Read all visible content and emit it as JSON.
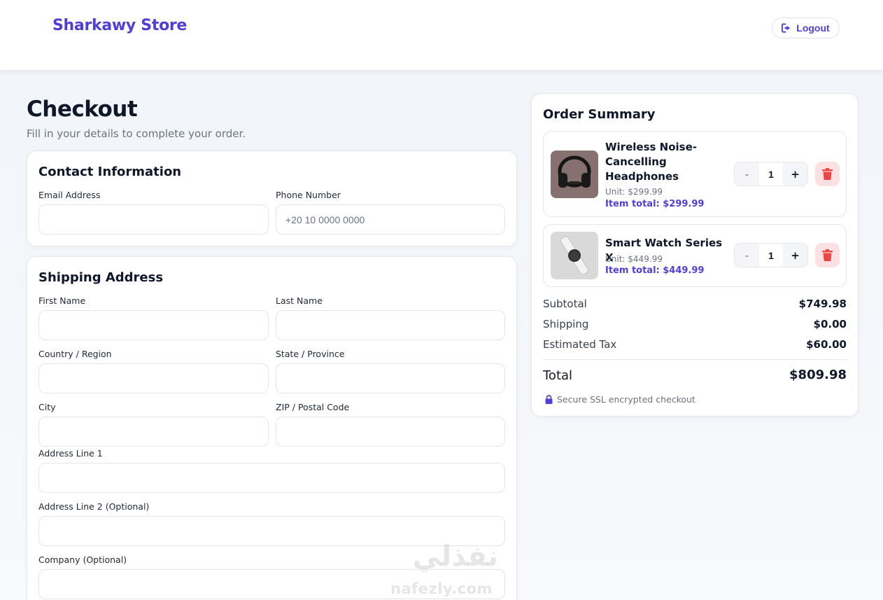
{
  "header": {
    "brand": "Sharkawy Store",
    "logout_label": "Logout"
  },
  "page": {
    "title": "Checkout",
    "subtitle": "Fill in your details to complete your order."
  },
  "contact": {
    "title": "Contact Information",
    "email_label": "Email Address",
    "email_value": "",
    "phone_label": "Phone Number",
    "phone_placeholder": "+20 10 0000 0000"
  },
  "shipping": {
    "title": "Shipping Address",
    "first_name_label": "First Name",
    "last_name_label": "Last Name",
    "country_label": "Country / Region",
    "state_label": "State / Province",
    "city_label": "City",
    "zip_label": "ZIP / Postal Code",
    "address1_label": "Address Line 1",
    "address2_label": "Address Line 2 (Optional)",
    "company_label": "Company (Optional)"
  },
  "summary": {
    "title": "Order Summary",
    "items": [
      {
        "name": "Wireless Noise-Cancelling Headphones",
        "unit": "Unit: $299.99",
        "total": "Item total: $299.99",
        "qty": "1",
        "thumb_icon": "headphones-photo"
      },
      {
        "name": "Smart Watch Series X",
        "unit": "Unit: $449.99",
        "total": "Item total: $449.99",
        "qty": "1",
        "thumb_icon": "smartwatch-photo"
      }
    ],
    "qty_minus": "-",
    "qty_plus": "+",
    "subtotal_label": "Subtotal",
    "subtotal_value": "$749.98",
    "shipping_label": "Shipping",
    "shipping_value": "$0.00",
    "tax_label": "Estimated Tax",
    "tax_value": "$60.00",
    "total_label": "Total",
    "total_value": "$809.98",
    "secure_text": "Secure SSL encrypted checkout"
  },
  "watermark": {
    "arabic": "نفذلي",
    "latin": "nafezly.com"
  },
  "colors": {
    "accent": "#4f3fd8",
    "danger": "#ef4444",
    "danger_bg": "#fde0e2",
    "text": "#0f172a",
    "muted": "#6b7280"
  }
}
